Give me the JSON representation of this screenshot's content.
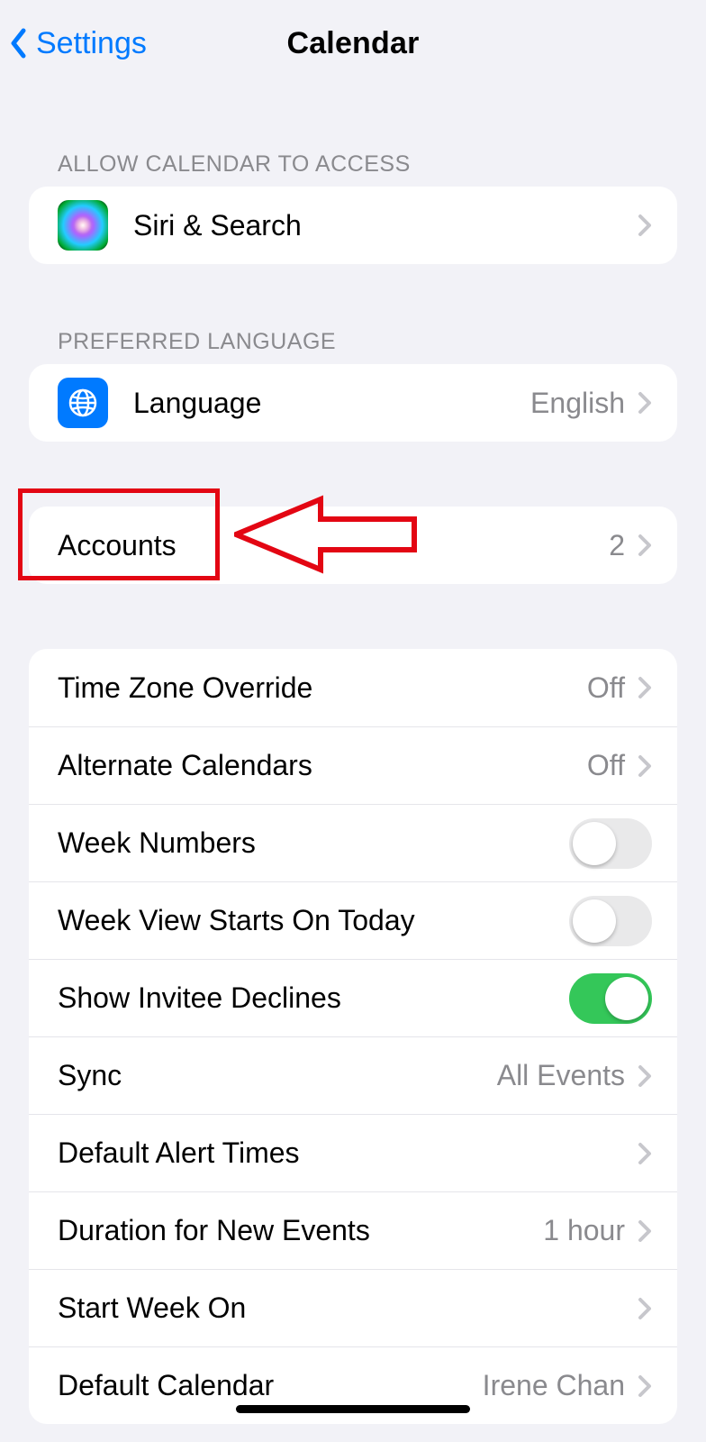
{
  "nav": {
    "back_label": "Settings",
    "title": "Calendar"
  },
  "section_access_header": "ALLOW CALENDAR TO ACCESS",
  "siri_row": {
    "label": "Siri & Search"
  },
  "section_lang_header": "PREFERRED LANGUAGE",
  "lang_row": {
    "label": "Language",
    "value": "English"
  },
  "accounts_row": {
    "label": "Accounts",
    "value": "2"
  },
  "prefs": [
    {
      "label": "Time Zone Override",
      "kind": "link",
      "value": "Off"
    },
    {
      "label": "Alternate Calendars",
      "kind": "link",
      "value": "Off"
    },
    {
      "label": "Week Numbers",
      "kind": "toggle",
      "on": false
    },
    {
      "label": "Week View Starts On Today",
      "kind": "toggle",
      "on": false
    },
    {
      "label": "Show Invitee Declines",
      "kind": "toggle",
      "on": true
    },
    {
      "label": "Sync",
      "kind": "link",
      "value": "All Events"
    },
    {
      "label": "Default Alert Times",
      "kind": "link",
      "value": ""
    },
    {
      "label": "Duration for New Events",
      "kind": "link",
      "value": "1 hour"
    },
    {
      "label": "Start Week On",
      "kind": "link",
      "value": ""
    },
    {
      "label": "Default Calendar",
      "kind": "link",
      "value": "Irene Chan"
    }
  ],
  "colors": {
    "tint": "#007aff",
    "green": "#34c759",
    "annotation": "#e30613"
  }
}
